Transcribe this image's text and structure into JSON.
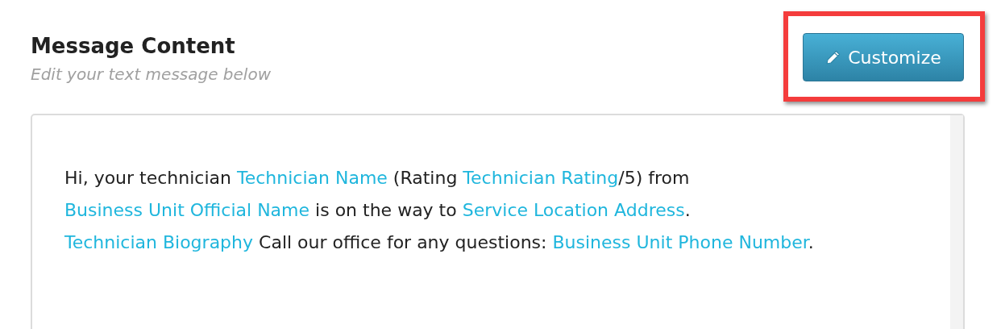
{
  "section": {
    "title": "Message Content",
    "subtitle": "Edit your text message below"
  },
  "button": {
    "label": "Customize",
    "highlighted": true
  },
  "message": {
    "lines": [
      [
        {
          "kind": "text",
          "text": "Hi, your technician "
        },
        {
          "kind": "token",
          "text": "Technician Name"
        },
        {
          "kind": "text",
          "text": " (Rating "
        },
        {
          "kind": "token",
          "text": "Technician Rating"
        },
        {
          "kind": "text",
          "text": "/5) from"
        }
      ],
      [
        {
          "kind": "token",
          "text": "Business Unit Official Name"
        },
        {
          "kind": "text",
          "text": " is on the way to "
        },
        {
          "kind": "token",
          "text": "Service Location Address"
        },
        {
          "kind": "text",
          "text": "."
        }
      ],
      [
        {
          "kind": "token",
          "text": "Technician Biography"
        },
        {
          "kind": "text",
          "text": " Call our office for any questions: "
        },
        {
          "kind": "token",
          "text": "Business Unit Phone Number"
        },
        {
          "kind": "text",
          "text": "."
        }
      ]
    ]
  }
}
